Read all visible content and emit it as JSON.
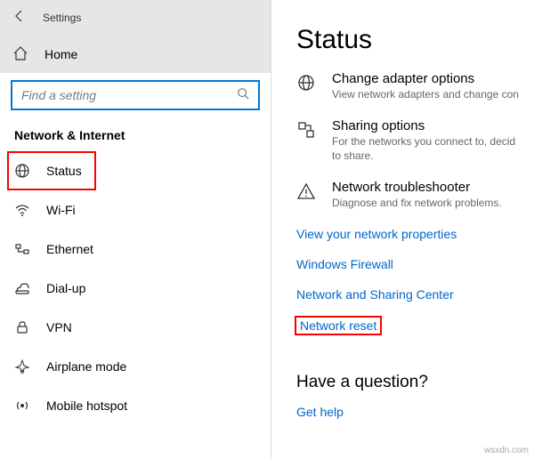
{
  "header": {
    "app_title": "Settings"
  },
  "home": {
    "label": "Home"
  },
  "search": {
    "placeholder": "Find a setting"
  },
  "section": {
    "title": "Network & Internet"
  },
  "nav": {
    "items": [
      {
        "label": "Status"
      },
      {
        "label": "Wi-Fi"
      },
      {
        "label": "Ethernet"
      },
      {
        "label": "Dial-up"
      },
      {
        "label": "VPN"
      },
      {
        "label": "Airplane mode"
      },
      {
        "label": "Mobile hotspot"
      }
    ]
  },
  "content": {
    "page_title": "Status",
    "options": [
      {
        "primary": "Change adapter options",
        "secondary": "View network adapters and change con"
      },
      {
        "primary": "Sharing options",
        "secondary": "For the networks you connect to, decid",
        "secondary2": "to share."
      },
      {
        "primary": "Network troubleshooter",
        "secondary": "Diagnose and fix network problems."
      }
    ],
    "links": [
      "View your network properties",
      "Windows Firewall",
      "Network and Sharing Center",
      "Network reset"
    ],
    "question_heading": "Have a question?",
    "help_link": "Get help"
  },
  "watermark": "wsxdn.com"
}
